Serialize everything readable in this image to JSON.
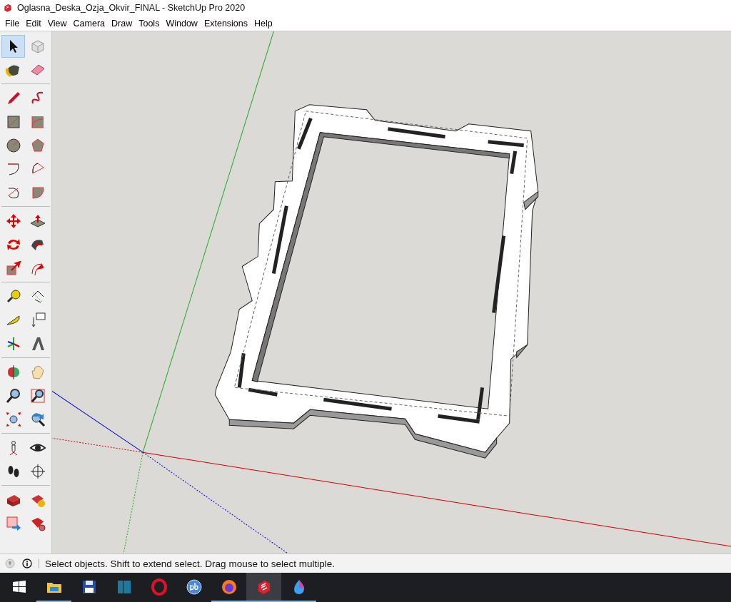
{
  "window": {
    "title": "Oglasna_Deska_Ozja_Okvir_FINAL - SketchUp Pro 2020"
  },
  "menu": [
    "File",
    "Edit",
    "View",
    "Camera",
    "Draw",
    "Tools",
    "Window",
    "Extensions",
    "Help"
  ],
  "tool_palette": {
    "groups": [
      [
        {
          "selected": true
        },
        {
          "selected": false
        },
        {
          "selected": false
        },
        {
          "selected": false
        }
      ],
      [
        {
          "selected": false
        },
        {
          "selected": false
        },
        {
          "selected": false
        },
        {
          "selected": false
        },
        {
          "selected": false
        },
        {
          "selected": false
        },
        {
          "selected": false
        },
        {
          "selected": false
        },
        {
          "selected": false
        },
        {
          "selected": false
        }
      ],
      [
        {
          "selected": false
        },
        {
          "selected": false
        },
        {
          "selected": false
        },
        {
          "selected": false
        },
        {
          "selected": false
        },
        {
          "selected": false
        }
      ],
      [
        {
          "selected": false
        },
        {
          "selected": false
        },
        {
          "selected": false
        },
        {
          "selected": false
        },
        {
          "selected": false
        },
        {
          "selected": false
        }
      ],
      [
        {
          "selected": false
        },
        {
          "selected": false
        },
        {
          "selected": false
        },
        {
          "selected": false
        },
        {
          "selected": false
        },
        {
          "selected": false
        }
      ],
      [
        {
          "selected": false
        },
        {
          "selected": false
        },
        {
          "selected": false
        },
        {
          "selected": false
        }
      ],
      [
        {
          "selected": false
        },
        {
          "selected": false
        },
        {
          "selected": false
        },
        {
          "selected": false
        }
      ]
    ]
  },
  "status_bar": {
    "message": "Select objects. Shift to extend select. Drag mouse to select multiple."
  },
  "taskbar": {
    "apps": [
      {
        "running": false,
        "selected": false
      },
      {
        "running": true,
        "selected": false
      },
      {
        "running": false,
        "selected": false
      },
      {
        "running": false,
        "selected": false
      },
      {
        "running": false,
        "selected": false
      },
      {
        "running": false,
        "selected": false
      },
      {
        "running": true,
        "selected": false
      },
      {
        "running": true,
        "selected": true
      },
      {
        "running": true,
        "selected": false
      }
    ]
  }
}
